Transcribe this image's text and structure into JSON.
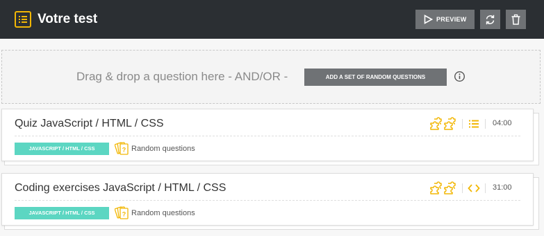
{
  "header": {
    "title": "Votre test",
    "title_icon": "list-icon",
    "preview_label": "PREVIEW",
    "accent_color": "#f2b705",
    "background_color": "#2b2f33"
  },
  "dropzone": {
    "text": "Drag & drop a question here - AND/OR -",
    "random_button_label": "ADD A SET OF RANDOM QUESTIONS"
  },
  "questions": [
    {
      "title": "Quiz JavaScript / HTML / CSS",
      "tag": "JAVASCRIPT / HTML / CSS",
      "random_label": "Random questions",
      "type_icon": "list-icon",
      "duration": "04:00"
    },
    {
      "title": "Coding exercises JavaScript / HTML / CSS",
      "tag": "JAVASCRIPT / HTML / CSS",
      "random_label": "Random questions",
      "type_icon": "code-icon",
      "duration": "31:00"
    }
  ],
  "colors": {
    "tag": "#5cd6c2",
    "button_grey": "#6f7275"
  }
}
